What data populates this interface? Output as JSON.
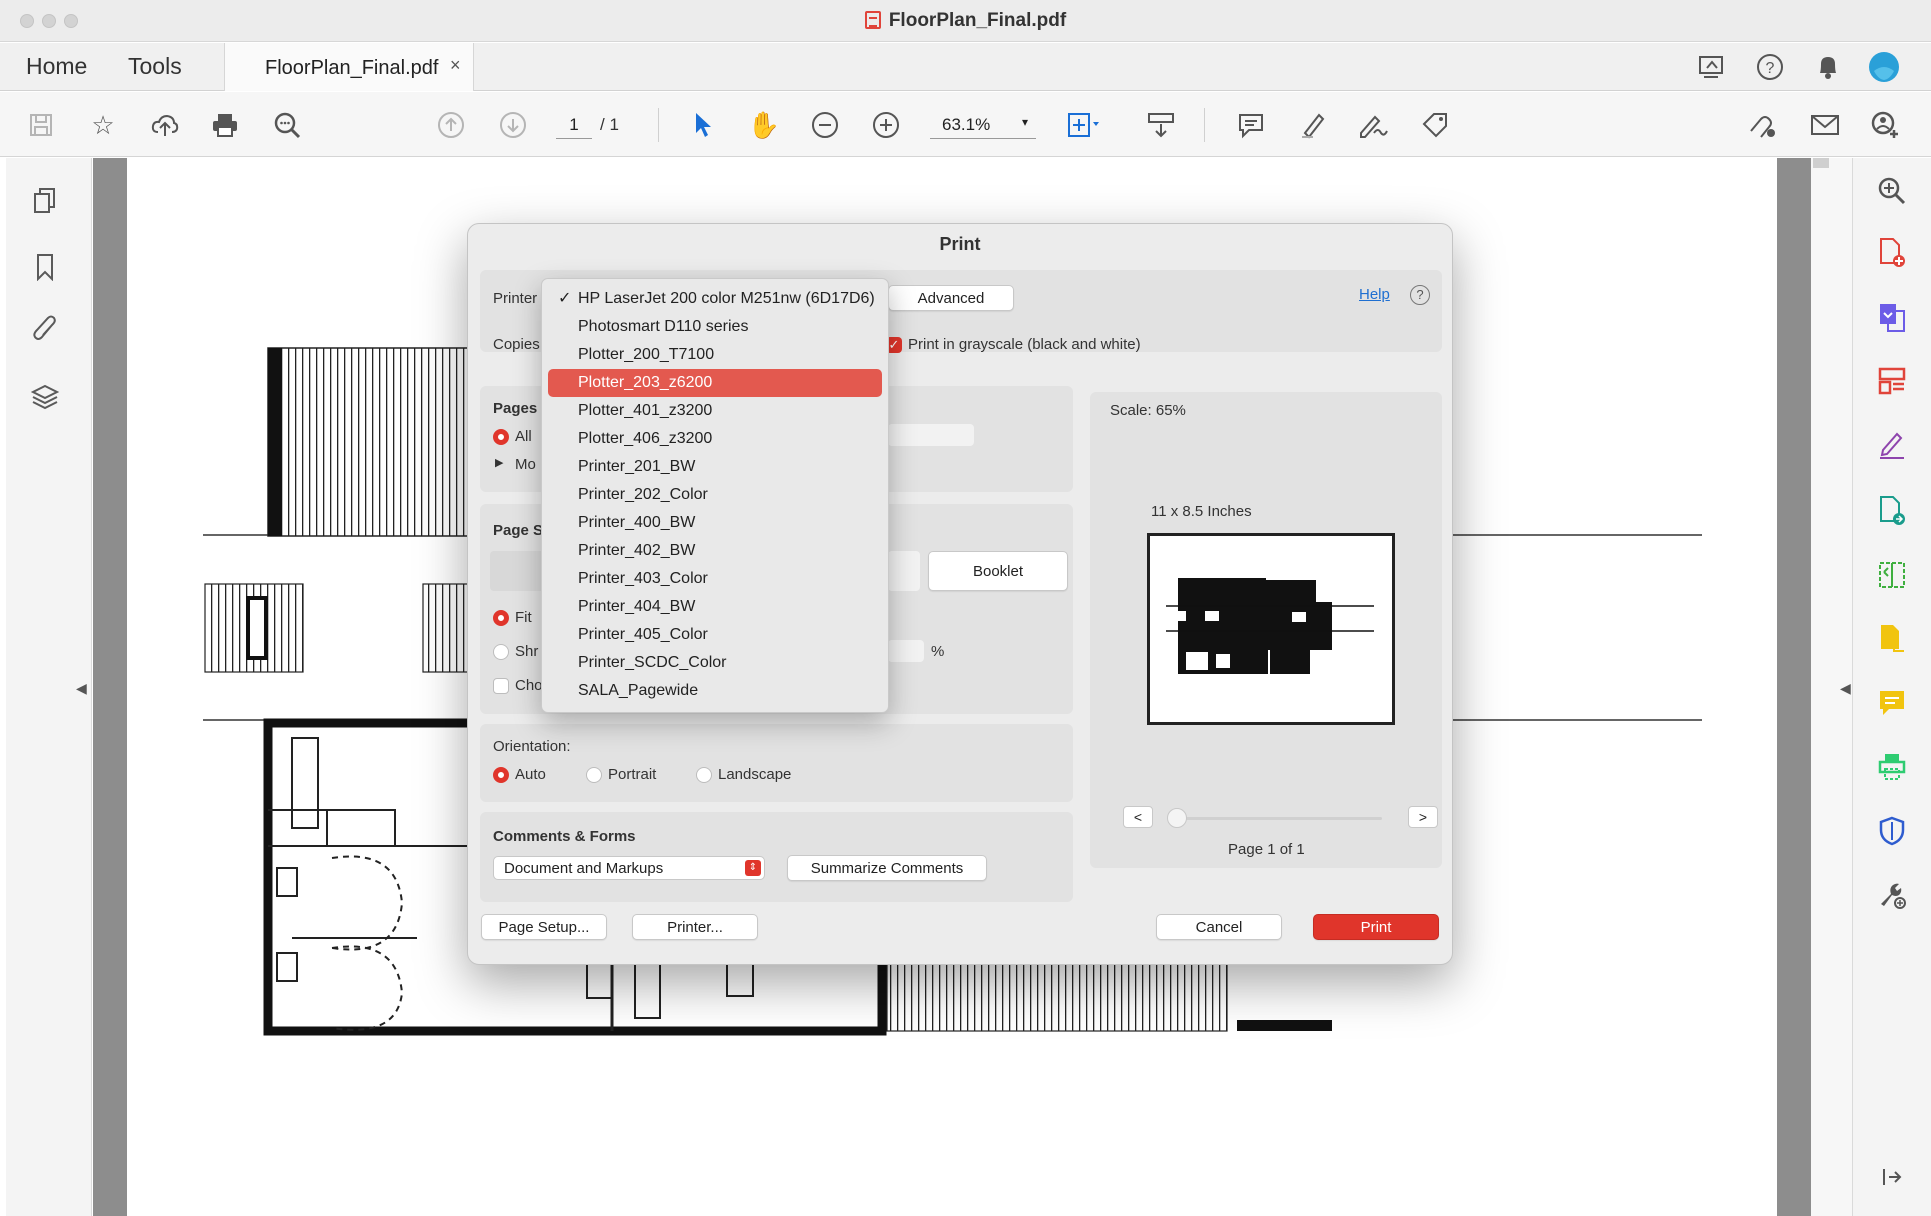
{
  "window": {
    "title": "FloorPlan_Final.pdf"
  },
  "nav": {
    "home": "Home",
    "tools": "Tools",
    "tab_title": "FloorPlan_Final.pdf",
    "tab_close": "×"
  },
  "toolbar": {
    "page_current": "1",
    "page_total": "/ 1",
    "zoom": "63.1%",
    "zoom_caret": "▾"
  },
  "dialog": {
    "title": "Print",
    "printer_label": "Printer",
    "copies_label": "Copies",
    "advanced": "Advanced",
    "help": "Help",
    "help_q": "?",
    "grayscale": "Print in grayscale (black and white)",
    "pages_label": "Pages",
    "pages_all": "All",
    "pages_more": "Mo",
    "page_sizing_label": "Page S",
    "booklet": "Booklet",
    "fit": "Fit",
    "shrink": "Shr",
    "choose": "Cho",
    "percent": "%",
    "orientation_label": "Orientation:",
    "orient_auto": "Auto",
    "orient_portrait": "Portrait",
    "orient_landscape": "Landscape",
    "comments_label": "Comments & Forms",
    "comments_value": "Document and Markups",
    "summarize": "Summarize Comments",
    "page_setup": "Page Setup...",
    "printer_btn": "Printer...",
    "cancel": "Cancel",
    "print": "Print",
    "scale": "Scale:  65%",
    "paper": "11 x 8.5 Inches",
    "prev": "<",
    "next": ">",
    "page_of": "Page 1 of 1"
  },
  "printer_menu": {
    "selected_index": 0,
    "highlighted_index": 3,
    "items": [
      "HP LaserJet 200 color M251nw (6D17D6)",
      "Photosmart D110 series",
      "Plotter_200_T7100",
      "Plotter_203_z6200",
      "Plotter_401_z3200",
      "Plotter_406_z3200",
      "Printer_201_BW",
      "Printer_202_Color",
      "Printer_400_BW",
      "Printer_402_BW",
      "Printer_403_Color",
      "Printer_404_BW",
      "Printer_405_Color",
      "Printer_SCDC_Color",
      "SALA_Pagewide"
    ]
  },
  "colors": {
    "accent": "#e0352b",
    "highlight": "#e3594f",
    "link": "#1f6fd1"
  }
}
